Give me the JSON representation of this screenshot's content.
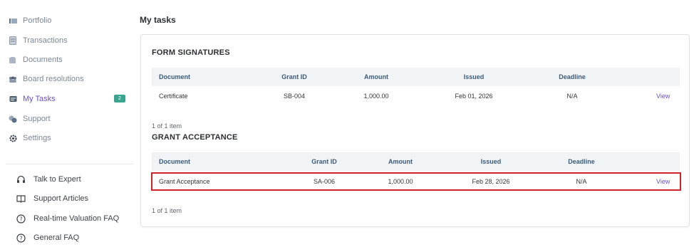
{
  "sidebar": {
    "items": [
      {
        "label": "Portfolio",
        "icon": "portfolio-icon"
      },
      {
        "label": "Transactions",
        "icon": "transactions-icon"
      },
      {
        "label": "Documents",
        "icon": "documents-icon"
      },
      {
        "label": "Board resolutions",
        "icon": "board-icon"
      },
      {
        "label": "My Tasks",
        "icon": "tasks-icon",
        "badge": "2",
        "active": true
      },
      {
        "label": "Support",
        "icon": "support-icon"
      },
      {
        "label": "Settings",
        "icon": "gear-icon"
      }
    ],
    "help": [
      {
        "label": "Talk to Expert",
        "icon": "headset-icon"
      },
      {
        "label": "Support Articles",
        "icon": "book-icon"
      },
      {
        "label": "Real-time Valuation FAQ",
        "icon": "question-icon"
      },
      {
        "label": "General FAQ",
        "icon": "question-icon"
      }
    ]
  },
  "main": {
    "title": "My tasks",
    "form_signatures": {
      "title": "FORM SIGNATURES",
      "columns": [
        "Document",
        "Grant ID",
        "Amount",
        "Issued",
        "Deadline"
      ],
      "rows": [
        {
          "document": "Certificate",
          "grant_id": "SB-004",
          "amount": "1,000.00",
          "issued": "Feb 01, 2026",
          "deadline": "N/A",
          "action": "View"
        }
      ],
      "count": "1 of 1 item"
    },
    "grant_acceptance": {
      "title": "GRANT ACCEPTANCE",
      "columns": [
        "Document",
        "Grant ID",
        "Amount",
        "Issued",
        "Deadline"
      ],
      "rows": [
        {
          "document": "Grant Acceptance",
          "grant_id": "SA-006",
          "amount": "1,000.00",
          "issued": "Feb 28, 2026",
          "deadline": "N/A",
          "action": "View"
        }
      ],
      "count": "1 of 1 item"
    }
  },
  "colors": {
    "accent": "#6b4fbb",
    "badge": "#3aa58e",
    "highlight": "#d0242b",
    "header_text": "#3b5a78"
  }
}
